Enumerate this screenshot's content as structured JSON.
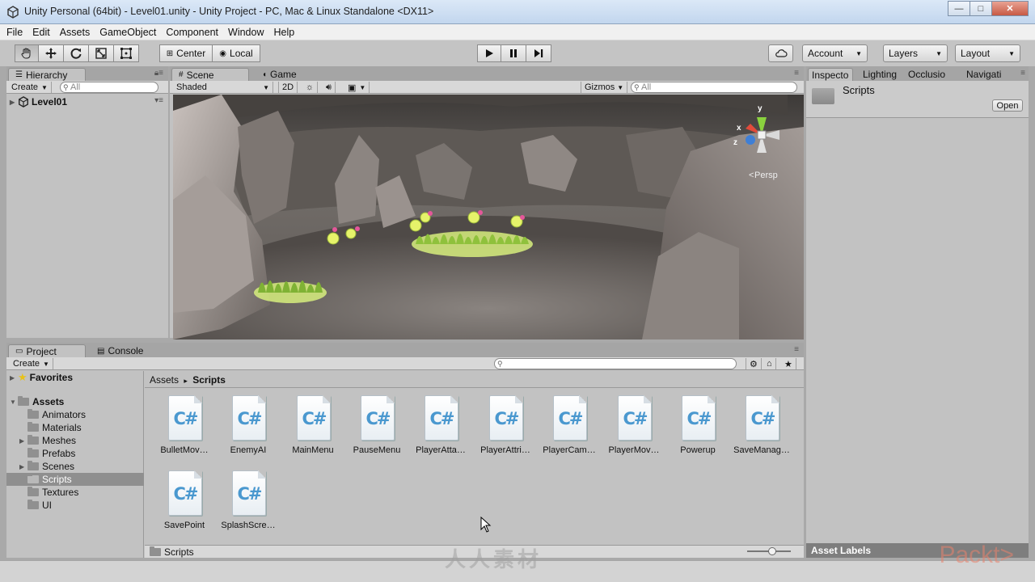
{
  "window": {
    "title": "Unity Personal (64bit) - Level01.unity - Unity Project - PC, Mac & Linux Standalone <DX11>",
    "minimize": "—",
    "maximize": "□",
    "close": "✕"
  },
  "menu": [
    "File",
    "Edit",
    "Assets",
    "GameObject",
    "Component",
    "Window",
    "Help"
  ],
  "toolbar": {
    "pivot": "Center",
    "space": "Local",
    "account": "Account",
    "layers": "Layers",
    "layout": "Layout"
  },
  "hierarchy": {
    "tab": "Hierarchy",
    "create": "Create",
    "search_placeholder": "All",
    "scene": "Level01"
  },
  "scene": {
    "tabs": [
      "Scene",
      "Game"
    ],
    "shading": "Shaded",
    "mode2d": "2D",
    "gizmos": "Gizmos",
    "search_placeholder": "All",
    "persp": "Persp",
    "gizmo_axes": {
      "y": "y",
      "x": "x",
      "z": "z"
    }
  },
  "project": {
    "tabs": [
      "Project",
      "Console"
    ],
    "create": "Create",
    "favorites": "Favorites",
    "assets_root": "Assets",
    "folders": [
      "Animators",
      "Materials",
      "Meshes",
      "Prefabs",
      "Scenes",
      "Scripts",
      "Textures",
      "UI"
    ],
    "breadcrumb": {
      "root": "Assets",
      "sep": "▸",
      "current": "Scripts"
    },
    "files": [
      "BulletMov…",
      "EnemyAI",
      "MainMenu",
      "PauseMenu",
      "PlayerAtta…",
      "PlayerAttri…",
      "PlayerCam…",
      "PlayerMov…",
      "Powerup",
      "SaveManag…",
      "SavePoint",
      "SplashScre…"
    ],
    "status": "Scripts"
  },
  "inspector": {
    "tabs": [
      "Inspecto",
      "Lighting",
      "Occlusio",
      "Navigati"
    ],
    "object_name": "Scripts",
    "open_button": "Open",
    "asset_labels": "Asset Labels"
  },
  "overlay": {
    "watermark": "人人素材",
    "brand": "Packt>"
  },
  "colors": {
    "panel": "#c2c2c2",
    "selection": "#8f8f8f",
    "csharp": "#4a98cf"
  }
}
